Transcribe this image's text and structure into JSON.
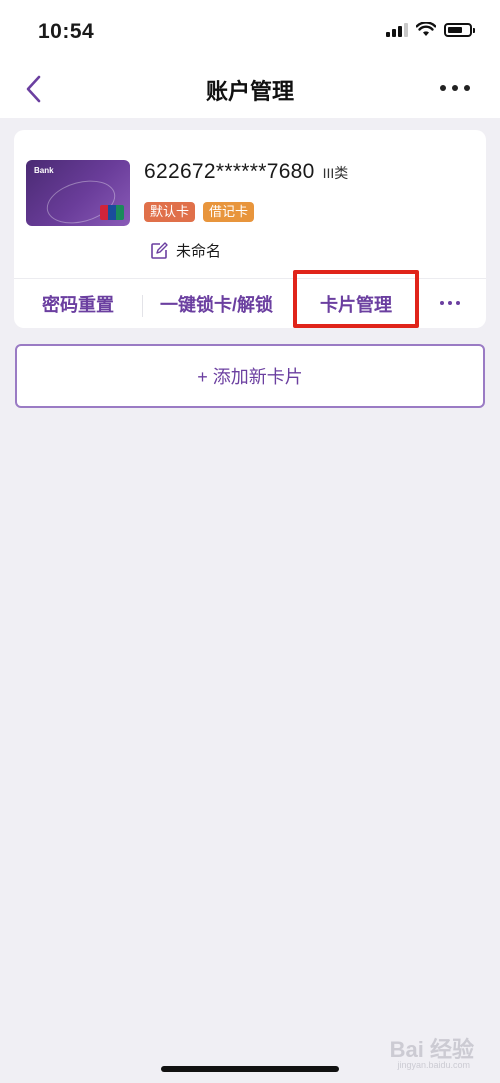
{
  "status_bar": {
    "time": "10:54"
  },
  "header": {
    "title": "账户管理",
    "back_icon": "chevron-left-icon",
    "more_icon": "more-horizontal-icon"
  },
  "card": {
    "number": "622672******7680",
    "class_label": "III类",
    "tags": [
      "默认卡",
      "借记卡"
    ],
    "nickname": "未命名",
    "thumb_logo": "Bank"
  },
  "actions": {
    "reset_password": "密码重置",
    "lock_unlock": "一键锁卡/解锁",
    "card_management": "卡片管理"
  },
  "add_card": {
    "label": "+ 添加新卡片"
  },
  "watermark": {
    "brand": "Bai 经验",
    "url": "jingyan.baidu.com"
  },
  "colors": {
    "accent": "#6b3fa0",
    "highlight_red": "#e0241a",
    "tag_default": "#e0704a",
    "tag_debit": "#e8953c",
    "background": "#f0eff4"
  }
}
